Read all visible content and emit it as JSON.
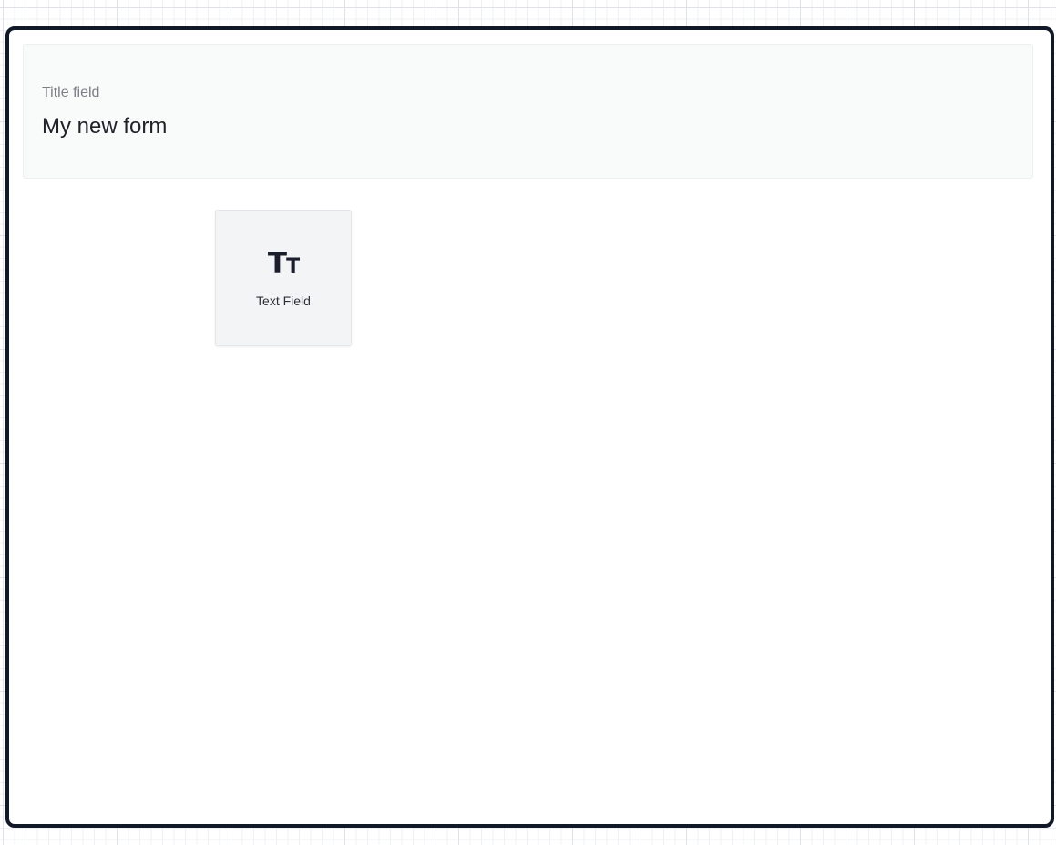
{
  "title_field": {
    "label": "Title field",
    "value": "My new form"
  },
  "palette": {
    "text_field": {
      "icon": "text-size-icon",
      "icon_glyph_upper": "T",
      "icon_glyph_lower": "T",
      "label": "Text Field"
    }
  },
  "colors": {
    "frame_border": "#111827",
    "grid_line": "#dfe3e8",
    "title_background": "#f9fafa",
    "card_background": "#f3f4f6"
  }
}
